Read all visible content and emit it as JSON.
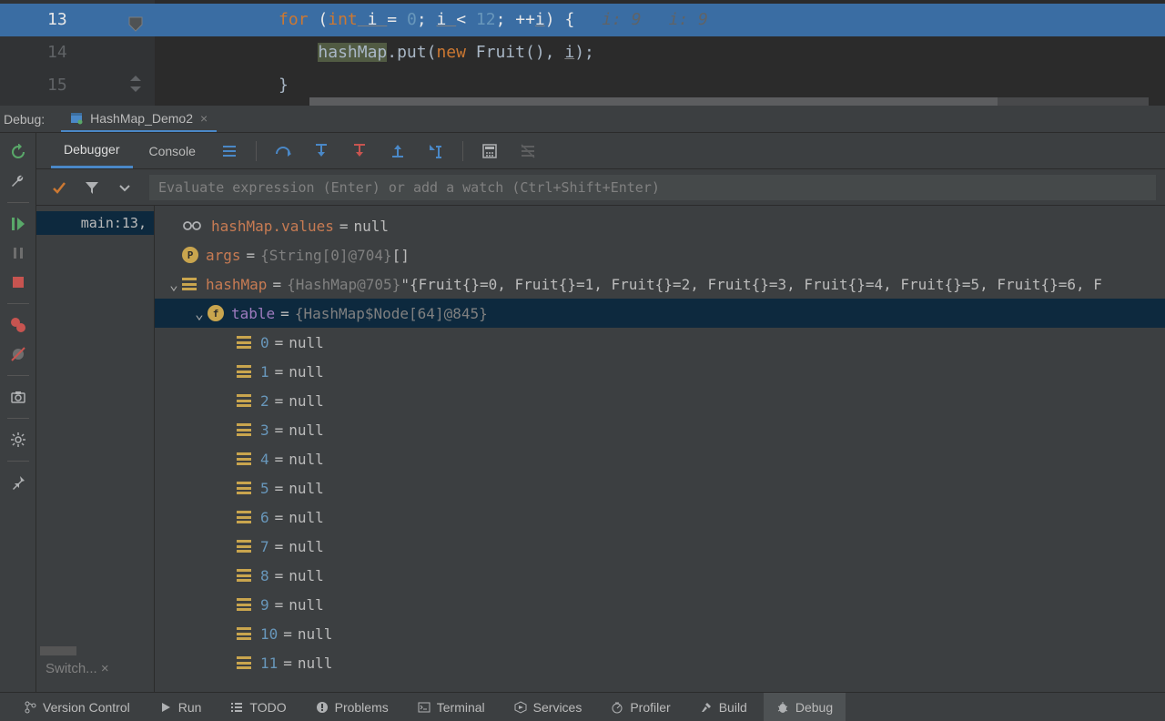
{
  "editor": {
    "lines": {
      "13": {
        "num": "13",
        "code_prefix": "            ",
        "kw": "for",
        "paren": " (",
        "kw2": "int",
        "var": " i ",
        "eq": "= ",
        "n0": "0",
        "semi1": "; ",
        "var2": "i ",
        "op": "< ",
        "n1": "12",
        "semi2": "; ++",
        "var3": "i",
        "close": ") {",
        "hint1": "i: 9",
        "hint2": "i: 9"
      },
      "14": {
        "num": "14",
        "prefix": "                ",
        "obj": "hashMap",
        "call": ".put(",
        "kw": "new ",
        "cls": "Fruit(), ",
        "var": "i",
        "end": ");"
      },
      "15": {
        "num": "15",
        "prefix": "            ",
        "brace": "}"
      }
    }
  },
  "debug": {
    "label": "Debug:",
    "config": "HashMap_Demo2",
    "tabs": {
      "debugger": "Debugger",
      "console": "Console"
    },
    "eval_placeholder": "Evaluate expression (Enter) or add a watch (Ctrl+Shift+Enter)",
    "frame": "main:13,",
    "switch": "Switch...",
    "vars": {
      "values": {
        "name": "hashMap.values",
        "val": "null"
      },
      "args": {
        "name": "args",
        "type": "{String[0]@704} ",
        "val": "[]"
      },
      "hashMap": {
        "name": "hashMap",
        "type": "{HashMap@705} ",
        "val": "\"{Fruit{}=0, Fruit{}=1, Fruit{}=2, Fruit{}=3, Fruit{}=4, Fruit{}=5, Fruit{}=6, F"
      },
      "table": {
        "name": "table",
        "type": "{HashMap$Node[64]@845}"
      },
      "entries": [
        {
          "idx": "0",
          "val": "null"
        },
        {
          "idx": "1",
          "val": "null"
        },
        {
          "idx": "2",
          "val": "null"
        },
        {
          "idx": "3",
          "val": "null"
        },
        {
          "idx": "4",
          "val": "null"
        },
        {
          "idx": "5",
          "val": "null"
        },
        {
          "idx": "6",
          "val": "null"
        },
        {
          "idx": "7",
          "val": "null"
        },
        {
          "idx": "8",
          "val": "null"
        },
        {
          "idx": "9",
          "val": "null"
        },
        {
          "idx": "10",
          "val": "null"
        },
        {
          "idx": "11",
          "val": "null"
        }
      ]
    }
  },
  "bottom": {
    "vc": "Version Control",
    "run": "Run",
    "todo": "TODO",
    "problems": "Problems",
    "terminal": "Terminal",
    "services": "Services",
    "profiler": "Profiler",
    "build": "Build",
    "debug": "Debug"
  }
}
